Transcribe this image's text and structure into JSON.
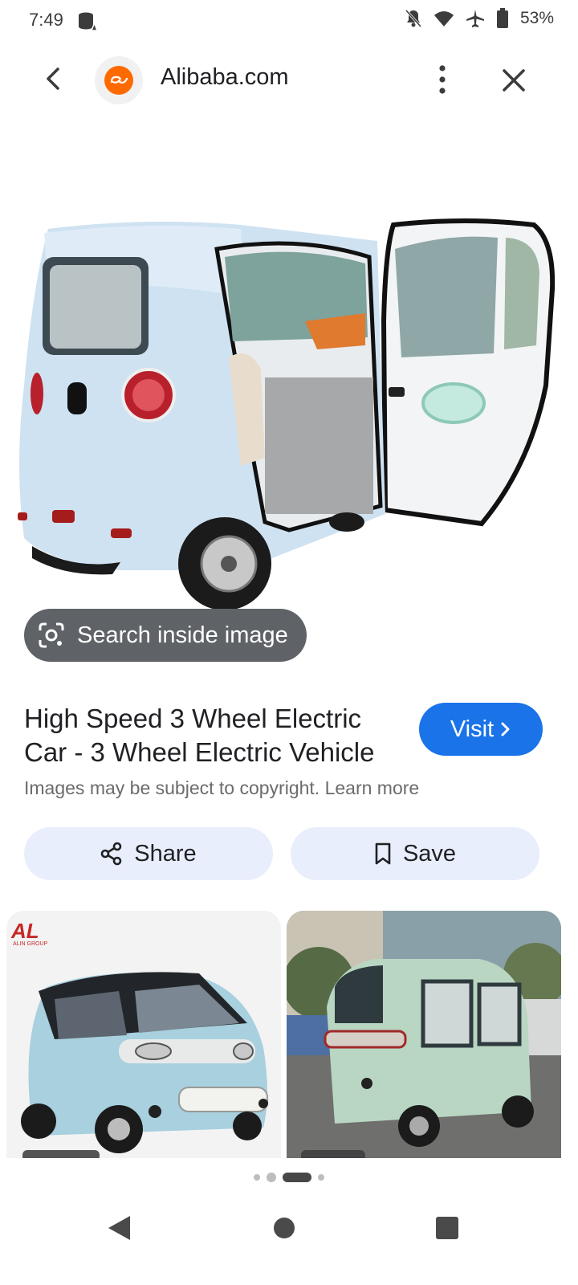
{
  "status": {
    "time": "7:49",
    "battery": "53%"
  },
  "header": {
    "site_name": "Alibaba.com"
  },
  "image": {
    "lens_label": "Search inside image"
  },
  "result": {
    "title": "High Speed 3 Wheel Electric Car - 3 Wheel Electric Vehicle",
    "visit_label": "Visit",
    "copyright": "Images may be subject to copyright. Learn more",
    "share_label": "Share",
    "save_label": "Save"
  },
  "related": {
    "brand_mark": "AL",
    "brand_sub": "ALIN GROUP"
  },
  "colors": {
    "accent": "#1a73e8",
    "chip_bg": "#e8eefb",
    "brand": "#ff6a00"
  },
  "icons": [
    "back-arrow-icon",
    "kebab-menu-icon",
    "close-icon",
    "lens-icon",
    "chevron-right-icon",
    "share-icon",
    "bookmark-icon",
    "nav-back-icon",
    "nav-home-icon",
    "nav-recents-icon"
  ]
}
